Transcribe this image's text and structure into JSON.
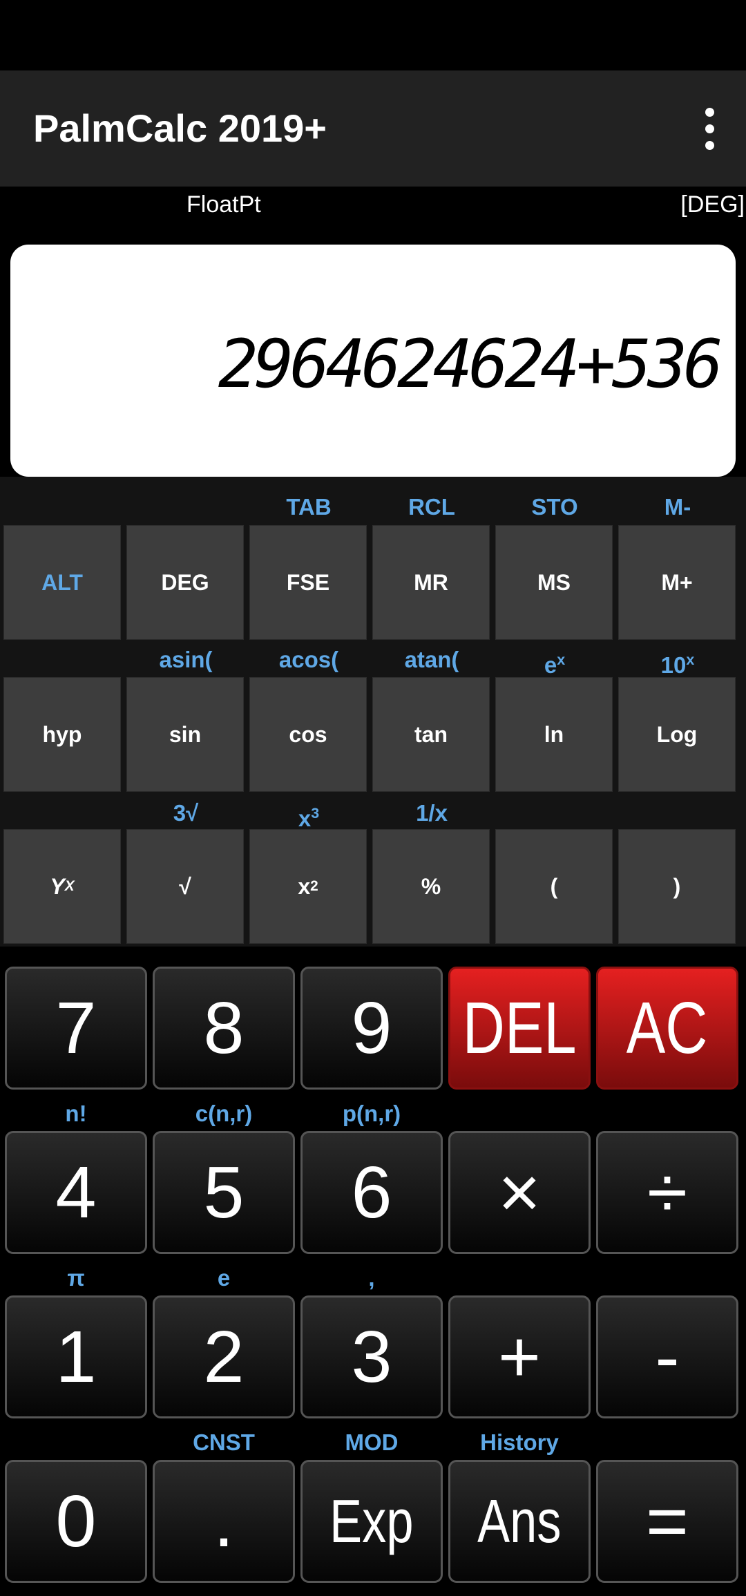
{
  "app": {
    "title": "PalmCalc 2019+"
  },
  "mode": {
    "format": "FloatPt",
    "angle": "[DEG]"
  },
  "display": {
    "value": "2964624624+536"
  },
  "scientific": {
    "row1_labels": [
      "",
      "",
      "TAB",
      "RCL",
      "STO",
      "M-"
    ],
    "row1_keys": [
      "ALT",
      "DEG",
      "FSE",
      "MR",
      "MS",
      "M+"
    ],
    "row2_labels": [
      "",
      "asin(",
      "acos(",
      "atan(",
      "e",
      "10"
    ],
    "row2_label_sups": [
      "",
      "",
      "",
      "",
      "x",
      "x"
    ],
    "row2_keys": [
      "hyp",
      "sin",
      "cos",
      "tan",
      "ln",
      "Log"
    ],
    "row3_labels": [
      "",
      "3√",
      "x",
      "1/x",
      "",
      ""
    ],
    "row3_label_sups": [
      "",
      "",
      "3",
      "",
      "",
      ""
    ],
    "row3_keys": [
      "Y",
      "√",
      "x",
      "%",
      "(",
      ")"
    ],
    "row3_key_sups": [
      "X",
      "",
      "2",
      "",
      "",
      ""
    ]
  },
  "keypad": {
    "row1_keys": [
      "7",
      "8",
      "9",
      "DEL",
      "AC"
    ],
    "row2_labels": [
      "n!",
      "c(n,r)",
      "p(n,r)",
      "",
      ""
    ],
    "row2_keys": [
      "4",
      "5",
      "6",
      "×",
      "÷"
    ],
    "row3_labels": [
      "π",
      "e",
      ",",
      "",
      ""
    ],
    "row3_keys": [
      "1",
      "2",
      "3",
      "+",
      "-"
    ],
    "row4_labels": [
      "",
      "CNST",
      "MOD",
      "History",
      ""
    ],
    "row4_keys": [
      "0",
      ".",
      "Exp",
      "Ans",
      "="
    ]
  },
  "colors": {
    "accent": "#5fa8e6",
    "key": "#3d3d3d",
    "danger": "#e52020"
  }
}
